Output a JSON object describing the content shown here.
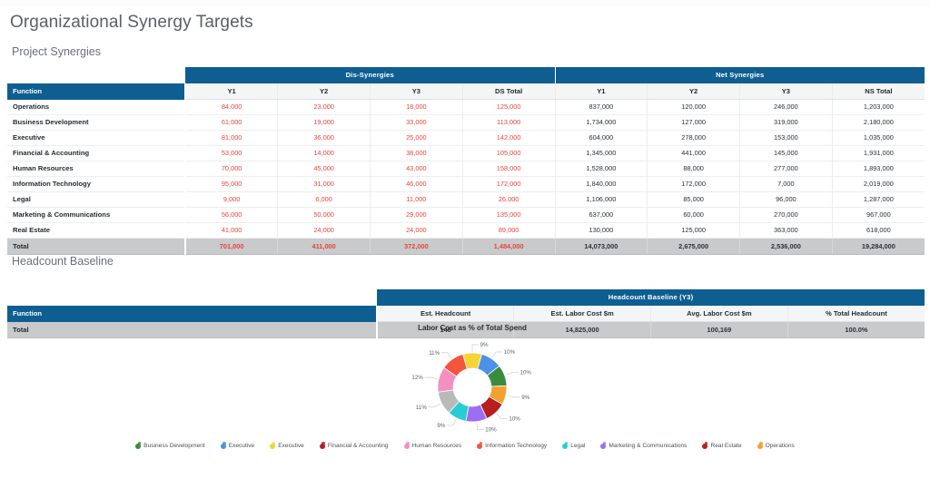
{
  "page": {
    "title": "Organizational Synergy Targets"
  },
  "sections": {
    "project_synergies": "Project Synergies",
    "headcount_baseline": "Headcount Baseline"
  },
  "colors": {
    "header_blue": "#0f5e92",
    "total_gray": "#c8cacb",
    "negative_red": "#e8453c",
    "text_dark": "#1f2933"
  },
  "synergy_table": {
    "groups": [
      {
        "label": "Dis-Synergies",
        "span": 4
      },
      {
        "label": "Net Synergies",
        "span": 4
      }
    ],
    "function_header": "Function",
    "columns": [
      "Y1",
      "Y2",
      "Y3",
      "DS Total",
      "Y1",
      "Y2",
      "Y3",
      "NS Total"
    ],
    "rows": [
      {
        "function": "Operations",
        "values": [
          "84,000",
          "23,000",
          "18,000",
          "125,000",
          "837,000",
          "120,000",
          "246,000",
          "1,203,000"
        ]
      },
      {
        "function": "Business Development",
        "values": [
          "61,000",
          "19,000",
          "33,000",
          "113,000",
          "1,734,000",
          "127,000",
          "319,000",
          "2,180,000"
        ]
      },
      {
        "function": "Executive",
        "values": [
          "81,000",
          "36,000",
          "25,000",
          "142,000",
          "604,000",
          "278,000",
          "153,000",
          "1,035,000"
        ]
      },
      {
        "function": "Financial & Accounting",
        "values": [
          "53,000",
          "14,000",
          "38,000",
          "105,000",
          "1,345,000",
          "441,000",
          "145,000",
          "1,931,000"
        ]
      },
      {
        "function": "Human Resources",
        "values": [
          "70,000",
          "45,000",
          "43,000",
          "158,000",
          "1,528,000",
          "88,000",
          "277,000",
          "1,893,000"
        ]
      },
      {
        "function": "Information Technology",
        "values": [
          "95,000",
          "31,000",
          "46,000",
          "172,000",
          "1,840,000",
          "172,000",
          "7,000",
          "2,019,000"
        ]
      },
      {
        "function": "Legal",
        "values": [
          "9,000",
          "6,000",
          "11,000",
          "26,000",
          "1,106,000",
          "85,000",
          "96,000",
          "1,287,000"
        ]
      },
      {
        "function": "Marketing & Communications",
        "values": [
          "56,000",
          "50,000",
          "29,000",
          "135,000",
          "637,000",
          "60,000",
          "270,000",
          "967,000"
        ]
      },
      {
        "function": "Real Estate",
        "values": [
          "41,000",
          "24,000",
          "24,000",
          "89,000",
          "130,000",
          "125,000",
          "363,000",
          "618,000"
        ]
      }
    ],
    "total": {
      "function": "Total",
      "values": [
        "701,000",
        "411,000",
        "372,000",
        "1,484,000",
        "14,073,000",
        "2,675,000",
        "2,536,000",
        "19,284,000"
      ]
    }
  },
  "headcount_table": {
    "groups": [
      {
        "label": "Headcount Baseline (Y3)",
        "span": 4
      }
    ],
    "function_header": "Function",
    "columns": [
      "Est. Headcount",
      "Est. Labor Cost $m",
      "Avg. Labor Cost $m",
      "% Total Headcount"
    ],
    "total": {
      "function": "Total",
      "values": [
        "148",
        "14,825,000",
        "100,169",
        "100.0%"
      ]
    }
  },
  "chart_data": {
    "type": "pie",
    "variant": "donut",
    "title": "Labor Cost as % of Total Spend",
    "categories": [
      "Executive",
      "Executive",
      "Business Development",
      "Operations",
      "Financial & Accounting",
      "Marketing & Communications",
      "Legal",
      "Real Estate",
      "Human Resources",
      "Information Technology"
    ],
    "values": [
      9,
      10,
      10,
      9,
      10,
      10,
      9,
      11,
      12,
      11
    ],
    "labels": [
      "9%",
      "10%",
      "10%",
      "9%",
      "10%",
      "10%",
      "9%",
      "11%",
      "12%",
      "11%"
    ],
    "colors": [
      "#f5d536",
      "#4d90e8",
      "#3a8a3f",
      "#f2a130",
      "#b81d20",
      "#9b6ef3",
      "#28ccd4",
      "#b9b9b9",
      "#f58ec1",
      "#f4553c"
    ],
    "legend_position": "bottom",
    "start_angle_deg": -16,
    "legend": [
      {
        "label": "Business Development",
        "color": "#3a8a3f"
      },
      {
        "label": "Executive",
        "color": "#4d90e8"
      },
      {
        "label": "Executive",
        "color": "#f5d536"
      },
      {
        "label": "Financial & Accounting",
        "color": "#b81d20"
      },
      {
        "label": "Human Resources",
        "color": "#f58ec1"
      },
      {
        "label": "Information Technology",
        "color": "#f4553c"
      },
      {
        "label": "Legal",
        "color": "#28ccd4"
      },
      {
        "label": "Marketing & Communications",
        "color": "#9b6ef3"
      },
      {
        "label": "Real Estate",
        "color": "#b81d20"
      },
      {
        "label": "Operations",
        "color": "#f2a130"
      }
    ]
  }
}
